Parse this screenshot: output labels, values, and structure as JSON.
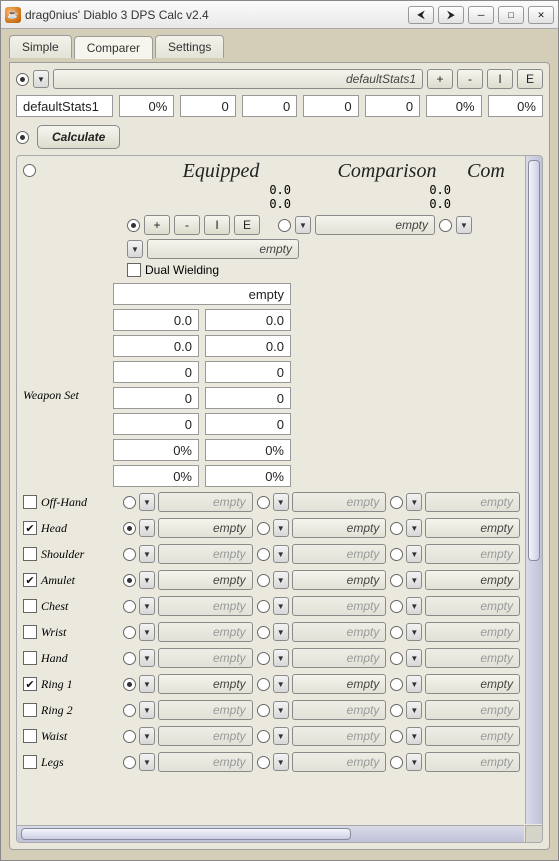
{
  "title": "drag0nius' Diablo 3 DPS Calc v2.4",
  "tabs": {
    "simple": "Simple",
    "comparer": "Comparer",
    "settings": "Settings",
    "active": 1
  },
  "statsCombo": "defaultStats1",
  "btn": {
    "plus": "+",
    "minus": "-",
    "I": "I",
    "E": "E"
  },
  "statsName": "defaultStats1",
  "statsVals": [
    "0%",
    "0",
    "0",
    "0",
    "0",
    "0%",
    "0%"
  ],
  "calculate": "Calculate",
  "headers": {
    "eq": "Equipped",
    "cmp": "Comparison",
    "cmp2": "Com"
  },
  "numsEq": [
    "0.0",
    "0.0"
  ],
  "numsCmp": [
    "0.0",
    "0.0"
  ],
  "emptyLabel": "empty",
  "dualWielding": "Dual Wielding",
  "weaponLabel": "Weapon Set",
  "weaponEmptyField": "empty",
  "weaponA": [
    "0.0",
    "0.0",
    "0",
    "0",
    "0",
    "0%",
    "0%"
  ],
  "weaponB": [
    "0.0",
    "0.0",
    "0",
    "0",
    "0",
    "0%",
    "0%"
  ],
  "slots": [
    {
      "name": "Off-Hand",
      "checked": false,
      "enabled": false
    },
    {
      "name": "Head",
      "checked": true,
      "enabled": true
    },
    {
      "name": "Shoulder",
      "checked": false,
      "enabled": false
    },
    {
      "name": "Amulet",
      "checked": true,
      "enabled": true
    },
    {
      "name": "Chest",
      "checked": false,
      "enabled": false
    },
    {
      "name": "Wrist",
      "checked": false,
      "enabled": false
    },
    {
      "name": "Hand",
      "checked": false,
      "enabled": false
    },
    {
      "name": "Ring 1",
      "checked": true,
      "enabled": true
    },
    {
      "name": "Ring 2",
      "checked": false,
      "enabled": false
    },
    {
      "name": "Waist",
      "checked": false,
      "enabled": false
    },
    {
      "name": "Legs",
      "checked": false,
      "enabled": false
    }
  ]
}
